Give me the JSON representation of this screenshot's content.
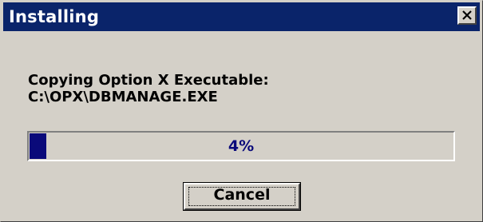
{
  "window": {
    "title": "Installing"
  },
  "titlebar": {
    "close_icon": "close-icon"
  },
  "message": {
    "line1": "Copying Option X Executable:",
    "line2": "C:\\OPX\\DBMANAGE.EXE"
  },
  "progress": {
    "percent": 4,
    "label": "4%",
    "fill_color": "#0a0a7a"
  },
  "buttons": {
    "cancel_label": "Cancel"
  },
  "colors": {
    "titlebar": "#0a246a",
    "dialog_face": "#d4d0c8"
  }
}
